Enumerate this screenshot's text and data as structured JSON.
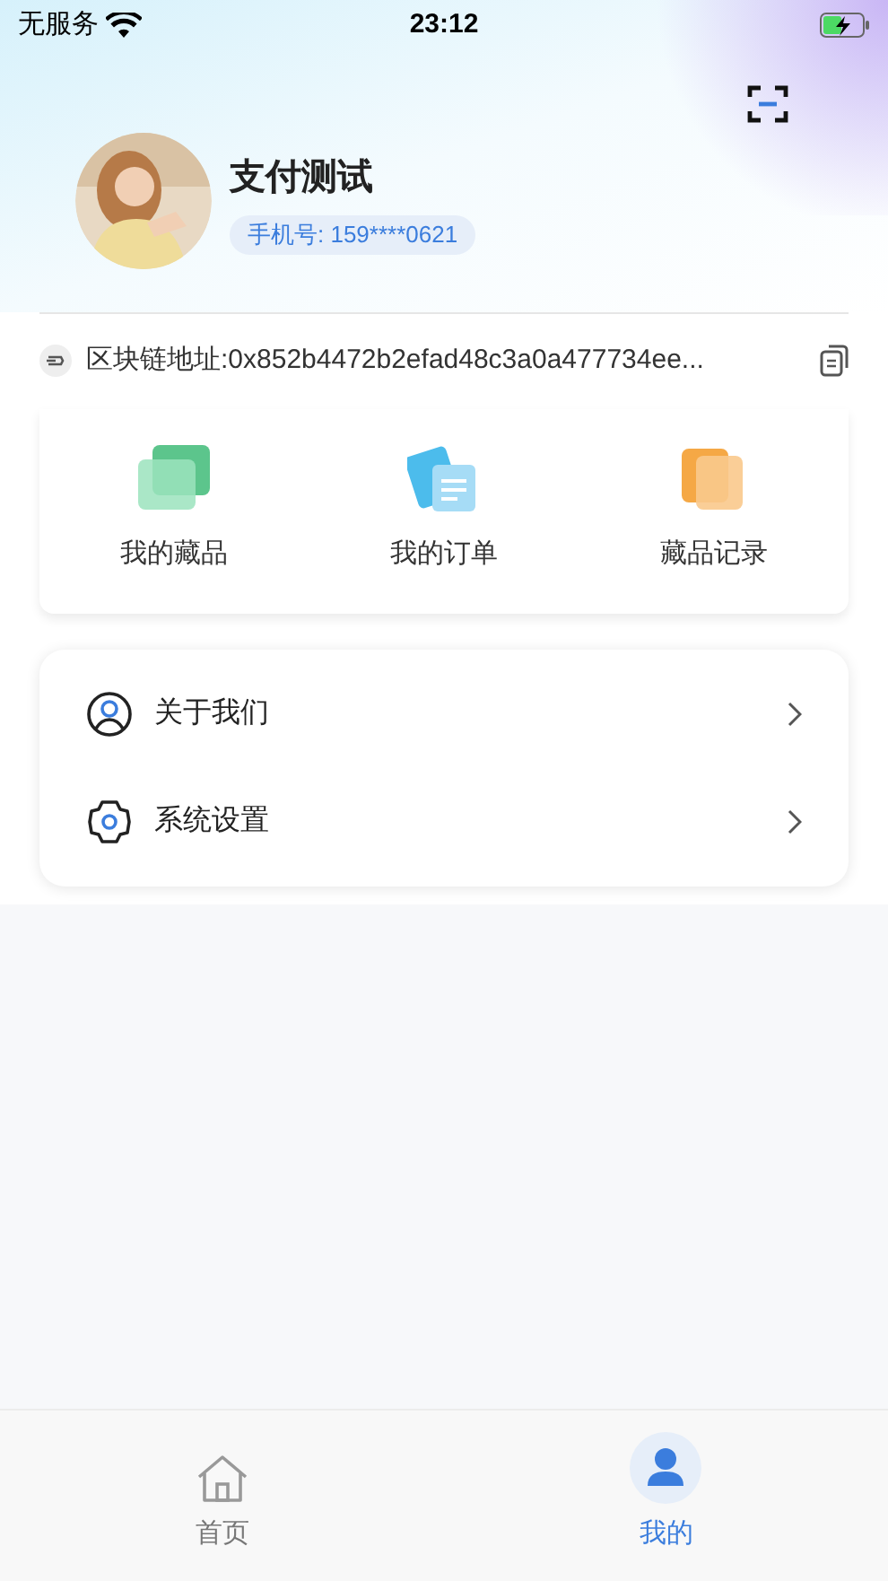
{
  "status_bar": {
    "carrier": "无服务",
    "time": "23:12"
  },
  "profile": {
    "name": "支付测试",
    "phone": "手机号: 159****0621"
  },
  "address": {
    "text": "区块链地址:0x852b4472b2efad48c3a0a477734ee..."
  },
  "shortcuts": [
    {
      "kind": "collection",
      "label": "我的藏品"
    },
    {
      "kind": "order",
      "label": "我的订单"
    },
    {
      "kind": "record",
      "label": "藏品记录"
    }
  ],
  "menu": [
    {
      "kind": "about",
      "label": "关于我们"
    },
    {
      "kind": "settings",
      "label": "系统设置"
    }
  ],
  "tab_bar": [
    {
      "kind": "home",
      "label": "首页",
      "selected": false
    },
    {
      "kind": "me",
      "label": "我的",
      "selected": true
    }
  ]
}
